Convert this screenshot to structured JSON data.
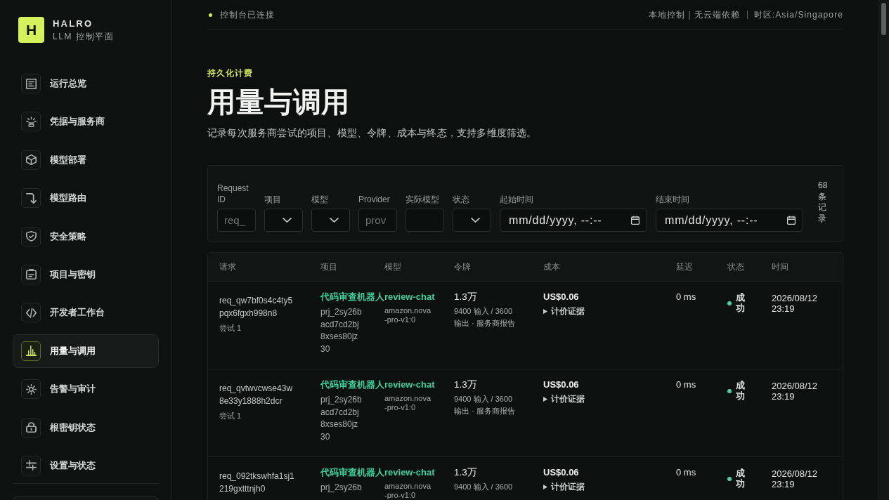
{
  "brand": {
    "logo_letter": "H",
    "name": "HALRO",
    "subtitle": "LLM 控制平面"
  },
  "sidebar": {
    "items": [
      {
        "label": "运行总览",
        "selected": false
      },
      {
        "label": "凭据与服务商",
        "selected": false
      },
      {
        "label": "模型部署",
        "selected": false
      },
      {
        "label": "模型路由",
        "selected": false
      },
      {
        "label": "安全策略",
        "selected": false
      },
      {
        "label": "项目与密钥",
        "selected": false
      },
      {
        "label": "开发者工作台",
        "selected": false
      },
      {
        "label": "用量与调用",
        "selected": true
      },
      {
        "label": "告警与审计",
        "selected": false
      },
      {
        "label": "根密钥状态",
        "selected": false
      },
      {
        "label": "设置与状态",
        "selected": false
      }
    ]
  },
  "topbar": {
    "status": "控制台已连接",
    "connected": true,
    "mode": "本地控制｜无云端依赖",
    "timezone": "时区:Asia/Singapore"
  },
  "header": {
    "eyebrow": "持久化计费",
    "title": "用量与调用",
    "description": "记录每次服务商尝试的项目、模型、令牌、成本与终态，支持多维度筛选。"
  },
  "filters": {
    "fields": [
      {
        "kind": "text",
        "label": "Request ID",
        "placeholder": "req_"
      },
      {
        "kind": "select",
        "label": "项目"
      },
      {
        "kind": "select",
        "label": "模型"
      },
      {
        "kind": "text",
        "label": "Provider",
        "placeholder": "prov"
      },
      {
        "kind": "text",
        "label": "实际模型"
      },
      {
        "kind": "select",
        "label": "状态"
      },
      {
        "kind": "datetime",
        "label": "起始时间",
        "placeholder": "mm/dd/yyyy, --:--"
      },
      {
        "kind": "datetime",
        "label": "结束时间",
        "placeholder": "mm/dd/yyyy, --:--"
      }
    ],
    "count": "68 条记录"
  },
  "table": {
    "columns": [
      "请求",
      "项目",
      "模型",
      "令牌",
      "成本",
      "延迟",
      "状态",
      "时间"
    ],
    "rows": [
      {
        "request_id": "req_qw7bf0s4c4ty5pqx6fgxh998n8",
        "attempt": "尝试 1",
        "project_name": "代码审查机器人",
        "project_id": "prj_2sy26bacd7cd2bj8xses80jz30",
        "deployment": "review-chat",
        "model": "amazon.nova-pro-v1:0",
        "tokens": "1.3万",
        "token_detail": "9400 输入 / 3600 输出 · 服务商报告",
        "cost": "US$0.06",
        "pricing": {
          "label": "计价证据",
          "expanded": false
        },
        "latency": "0 ms",
        "status": {
          "label": "成功",
          "color": "#4fd1a0"
        },
        "time": "2026/08/12 23:19"
      },
      {
        "request_id": "req_qvtwvcwse43w8e33y1888h2dcr",
        "attempt": "尝试 1",
        "project_name": "代码审查机器人",
        "project_id": "prj_2sy26bacd7cd2bj8xses80jz30",
        "deployment": "review-chat",
        "model": "amazon.nova-pro-v1:0",
        "tokens": "1.3万",
        "token_detail": "9400 输入 / 3600 输出 · 服务商报告",
        "cost": "US$0.06",
        "pricing": {
          "label": "计价证据",
          "expanded": false
        },
        "latency": "0 ms",
        "status": {
          "label": "成功",
          "color": "#4fd1a0"
        },
        "time": "2026/08/12 23:19"
      },
      {
        "request_id": "req_092tkswhfa1sj1219gxtttnjh0",
        "project_name": "代码审查机器人",
        "project_id": "prj_2sy26b",
        "deployment": "review-chat",
        "model": "amazon.nova-pro-v1:0",
        "tokens": "1.3万",
        "token_detail": "9400 输入 / 3600",
        "cost": "US$0.06",
        "pricing": {
          "label": "计价证据",
          "expanded": false
        },
        "latency": "0 ms",
        "status": {
          "label": "成功",
          "color": "#4fd1a0"
        },
        "time": "2026/08/12 23:19"
      }
    ]
  }
}
